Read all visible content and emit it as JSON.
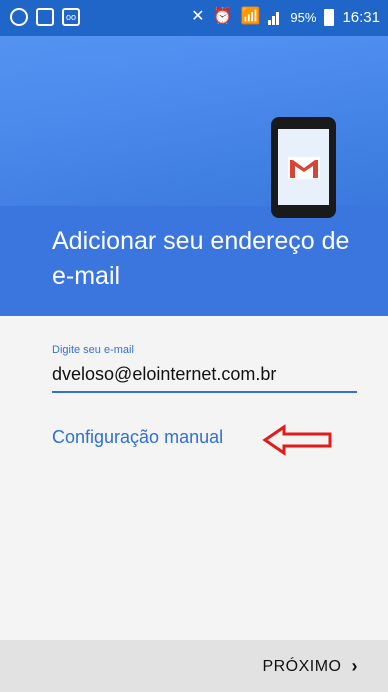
{
  "status_bar": {
    "left_icons": [
      "whatsapp-icon",
      "image-icon",
      "voicemail-icon"
    ],
    "right_icons": [
      "mute-icon",
      "alarm-icon",
      "wifi-icon",
      "signal-icon"
    ],
    "battery_percent": "95%",
    "time": "16:31"
  },
  "header": {
    "title": "Adicionar seu endereço de e-mail",
    "illustration": "gmail-phone-icon"
  },
  "form": {
    "email_label": "Digite seu e-mail",
    "email_value": "dveloso@elointernet.com.br"
  },
  "manual_setup_link": "Configuração manual",
  "annotation_arrow_color": "#e31b1b",
  "bottom_bar": {
    "next_label": "PRÓXIMO"
  },
  "colors": {
    "accent_blue": "#3670d6",
    "header_blue": "#3d7fe6",
    "status_bar": "#1f66c8"
  }
}
